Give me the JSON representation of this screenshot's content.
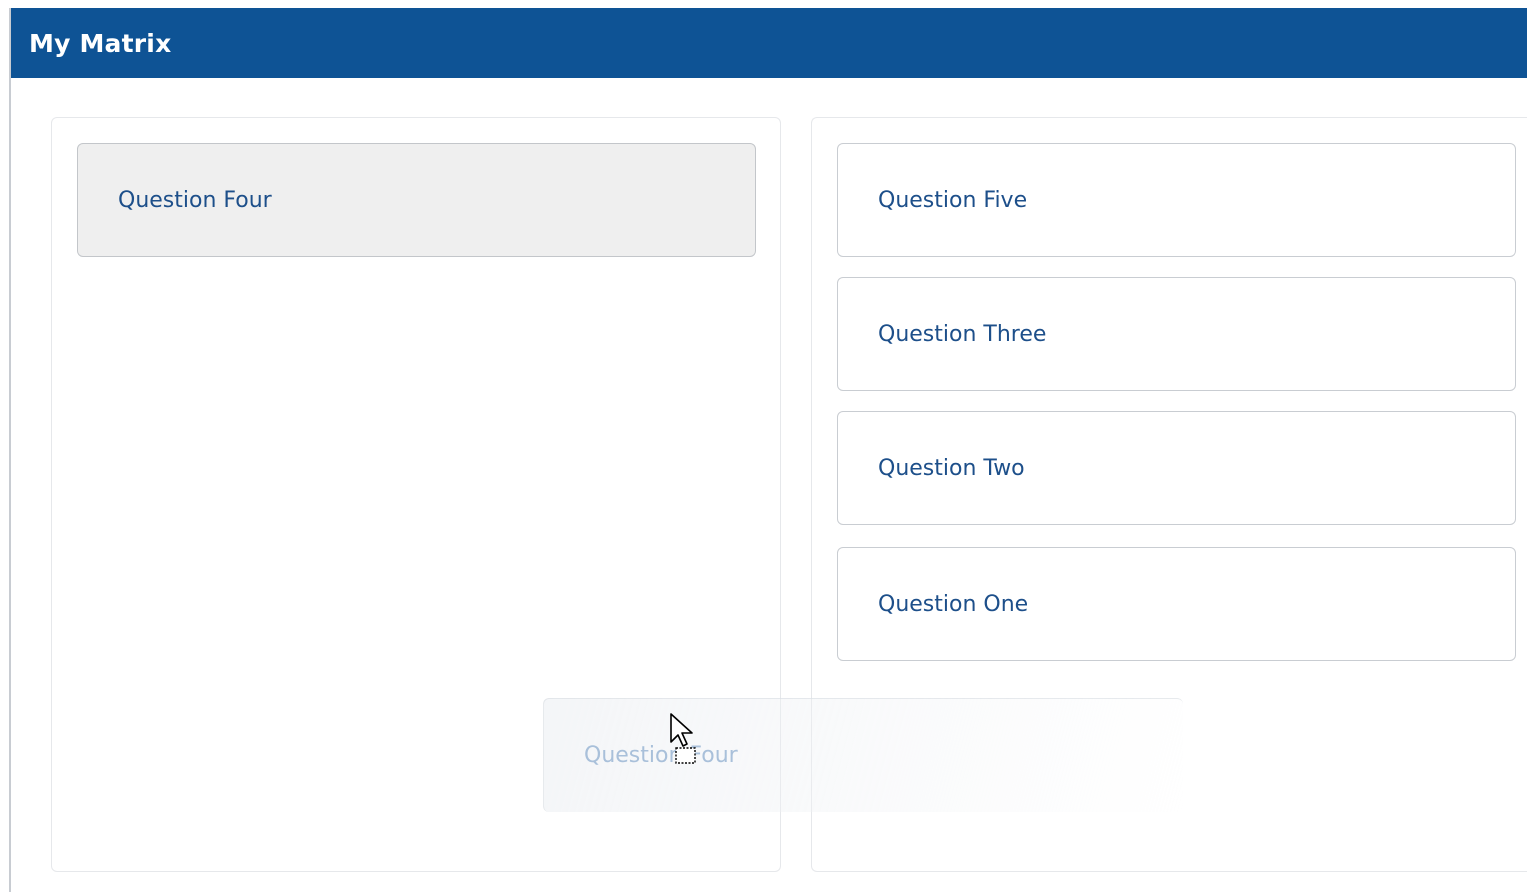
{
  "window": {
    "title": "My Matrix"
  },
  "left_column": {
    "items": [
      {
        "label": "Question Four"
      }
    ]
  },
  "right_column": {
    "items": [
      {
        "label": "Question Five"
      },
      {
        "label": "Question Three"
      },
      {
        "label": "Question Two"
      },
      {
        "label": "Question One"
      }
    ]
  },
  "drag": {
    "label": "Question Four",
    "cursor_icon": "arrow-cursor-with-drag-icon"
  },
  "colors": {
    "titlebar": "#0e5395",
    "item_text": "#1d4f8a",
    "selected_item_bg": "#efefef",
    "ghost_text": "#a9c0da"
  }
}
